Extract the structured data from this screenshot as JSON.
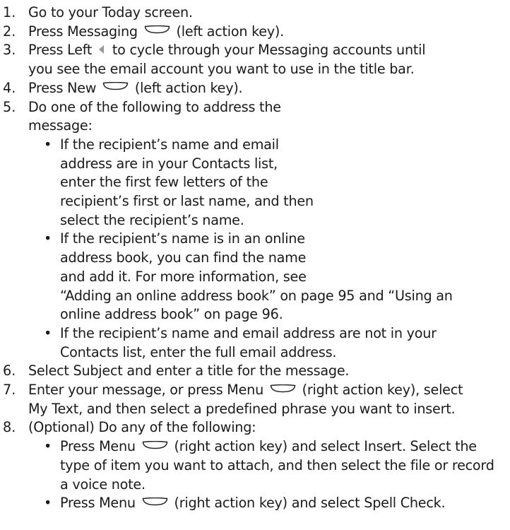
{
  "steps": [
    {
      "num": "1.",
      "lines": [
        [
          "Go to your Today screen."
        ]
      ]
    },
    {
      "num": "2.",
      "lines": [
        [
          "Press Messaging ",
          {
            "icon": "action-key-icon"
          },
          " (left action key)."
        ]
      ]
    },
    {
      "num": "3.",
      "lines": [
        [
          "Press Left ",
          {
            "icon": "left-arrow-icon"
          },
          " to cycle through your Messaging accounts until"
        ],
        [
          "you see the email account you want to use in the title bar."
        ]
      ]
    },
    {
      "num": "4.",
      "lines": [
        [
          "Press New ",
          {
            "icon": "action-key-icon"
          },
          " (left action key)."
        ]
      ]
    },
    {
      "num": "5.",
      "lines": [
        [
          "Do one of the following to address the"
        ],
        [
          "message:"
        ]
      ],
      "bullets": [
        {
          "lines": [
            "If the recipient’s name and email",
            "address are in your Contacts list,",
            "enter the first few letters of the",
            "recipient’s first or last name, and then",
            "select the recipient’s name."
          ]
        },
        {
          "lines": [
            "If the recipient’s name is in an online",
            "address book, you can find the name",
            "and add it. For more information, see",
            "“Adding an online address book” on page 95 and “Using an",
            "online address book” on page 96."
          ]
        },
        {
          "lines": [
            "If the recipient’s name and email address are not in your",
            "Contacts list, enter the full email address."
          ]
        }
      ]
    },
    {
      "num": "6.",
      "lines": [
        [
          "Select Subject and enter a title for the message."
        ]
      ]
    },
    {
      "num": "7.",
      "lines": [
        [
          "Enter your message, or press Menu ",
          {
            "icon": "action-key-icon"
          },
          " (right action key), select"
        ],
        [
          "My Text, and then select a predefined phrase you want to insert."
        ]
      ]
    },
    {
      "num": "8.",
      "lines": [
        [
          "(Optional) Do any of the following:"
        ]
      ],
      "bullets": [
        {
          "lines": [
            [
              "Press Menu ",
              {
                "icon": "action-key-icon"
              },
              " (right action key) and select Insert. Select the"
            ],
            "type of item you want to attach, and then select the file or record",
            "a voice note."
          ]
        },
        {
          "lines": [
            [
              "Press Menu ",
              {
                "icon": "action-key-icon"
              },
              " (right action key) and select Spell Check."
            ]
          ]
        }
      ]
    }
  ],
  "bullet_char": "•"
}
